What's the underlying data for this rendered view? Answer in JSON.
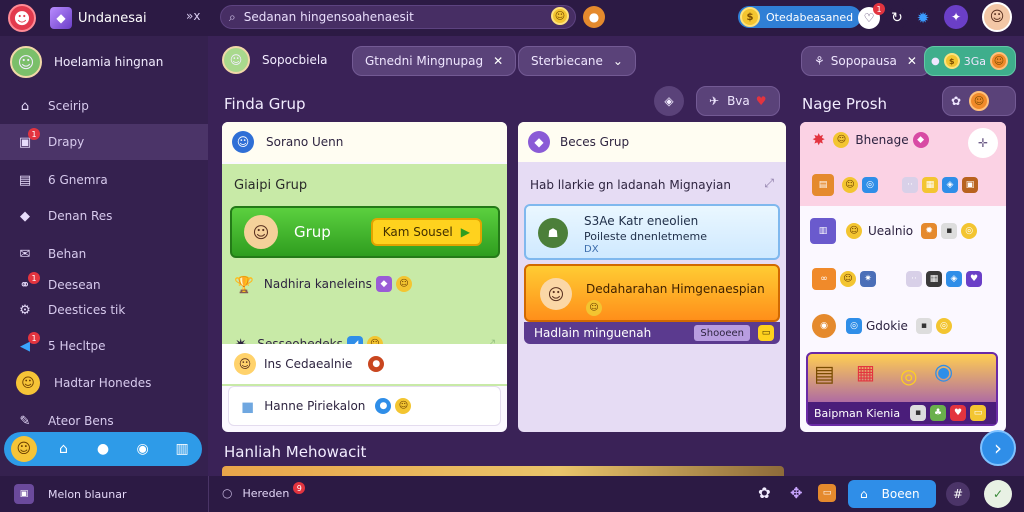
{
  "app": {
    "title": "Undanesai",
    "collapse_icon": "»x"
  },
  "search": {
    "value": "Sedanan hingensoahenaesit"
  },
  "topbar": {
    "coins_label": "Otedabeasaned"
  },
  "user": {
    "name": "Hoelamia hingnan"
  },
  "sidebar": {
    "items": [
      {
        "label": "Sceirip",
        "icon": "home-icon"
      },
      {
        "label": "Drapy",
        "icon": "chat-icon",
        "badge": "1"
      },
      {
        "label": "6 Gnemra",
        "icon": "mail-icon"
      },
      {
        "label": "Denan Res",
        "icon": "bubble-icon"
      },
      {
        "label": "Behan",
        "icon": "envelope-icon"
      },
      {
        "label": "Deesean",
        "icon": "link-icon",
        "badge": "1"
      },
      {
        "label": "Deestices tik",
        "icon": "gear-icon"
      },
      {
        "label": "5 Hecltpe",
        "icon": "speaker-icon",
        "badge": "1"
      },
      {
        "label": "Hadtar Honedes",
        "icon": "smiley-icon"
      },
      {
        "label": "Ateor Bens",
        "icon": "pencil-icon"
      }
    ]
  },
  "header": {
    "profile_label": "Sopocbiela",
    "chip1": "Gtnedni Mingnupag",
    "chip2": "Sterbiecane",
    "chip_right1": "Sopopausa",
    "chip_right2": "3Ga"
  },
  "sections": {
    "left_title": "Finda Grup",
    "middle_action": "Bva",
    "right_title": "Nage Prosh",
    "bottom_title": "Hanliah Mehowacit"
  },
  "panel_left": {
    "header": "Sorano Uenn",
    "group_title": "Giaipi Grup",
    "cta_label": "Grup",
    "cta_button": "Kam Sousel",
    "rows": [
      {
        "label": "Nadhira kaneleins"
      },
      {
        "label": "Sesseohedeks"
      },
      {
        "label": "Ins Cedaealnie"
      },
      {
        "label": "Hanne Piriekalon"
      }
    ]
  },
  "panel_mid": {
    "header": "Beces Grup",
    "subtitle": "Hab llarkie gn ladanah Mignayian",
    "card1_title": "S3Ae Katr eneolien",
    "card1_line": "Poileste dnenletmeme",
    "card1_meta": "DX",
    "card2_title": "Dedaharahan Himgenaespian",
    "bar_label": "Hadlain minguenah",
    "bar_button": "Shooeen"
  },
  "panel_right": {
    "row1": "Bhenage",
    "row2": "Uealnio",
    "row3": "Gdokie",
    "promo_label": "Baipman Kienia"
  },
  "bottombar": {
    "left_label": "Melon blaunar",
    "mid_label": "Hereden",
    "badge": "9",
    "primary_button": "Boeen"
  },
  "colors": {
    "background": "#3a2257",
    "sidebar": "#35214f",
    "topbar": "#2c1a44",
    "accent_blue": "#2f8ee8",
    "accent_green": "#3cb52a",
    "accent_orange": "#ff9b1f"
  }
}
